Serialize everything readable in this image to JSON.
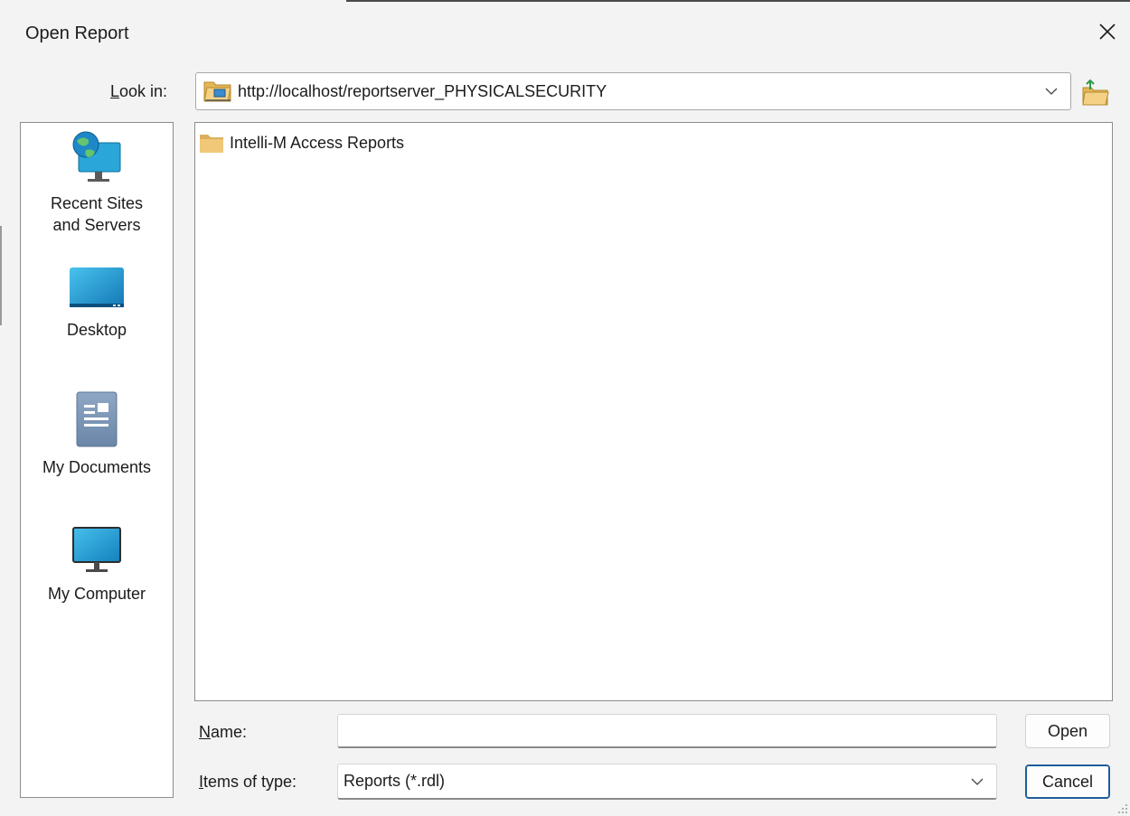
{
  "window": {
    "title": "Open Report",
    "close_icon": "close-icon"
  },
  "toolbar": {
    "look_in_label": "Look in:",
    "look_in_value": "http://localhost/reportserver_PHYSICALSECURITY",
    "location_icon": "network-folder-icon",
    "up_button_icon": "up-one-level-folder-icon"
  },
  "places": [
    {
      "label_line1": "Recent Sites",
      "label_line2": "and Servers",
      "icon": "globe-monitor-icon"
    },
    {
      "label_line1": "Desktop",
      "label_line2": "",
      "icon": "desktop-icon"
    },
    {
      "label_line1": "My Documents",
      "label_line2": "",
      "icon": "documents-icon"
    },
    {
      "label_line1": "My Computer",
      "label_line2": "",
      "icon": "computer-icon"
    }
  ],
  "files": [
    {
      "name": "Intelli-M Access Reports",
      "icon": "folder-icon"
    }
  ],
  "name_field": {
    "label": "Name:",
    "value": ""
  },
  "type_field": {
    "label": "Items of type:",
    "value": "Reports (*.rdl)"
  },
  "buttons": {
    "open": "Open",
    "cancel": "Cancel"
  },
  "colors": {
    "background": "#f3f3f3",
    "panel": "#ffffff",
    "accent": "#1c5d99",
    "folder": "#e8bf6a"
  }
}
